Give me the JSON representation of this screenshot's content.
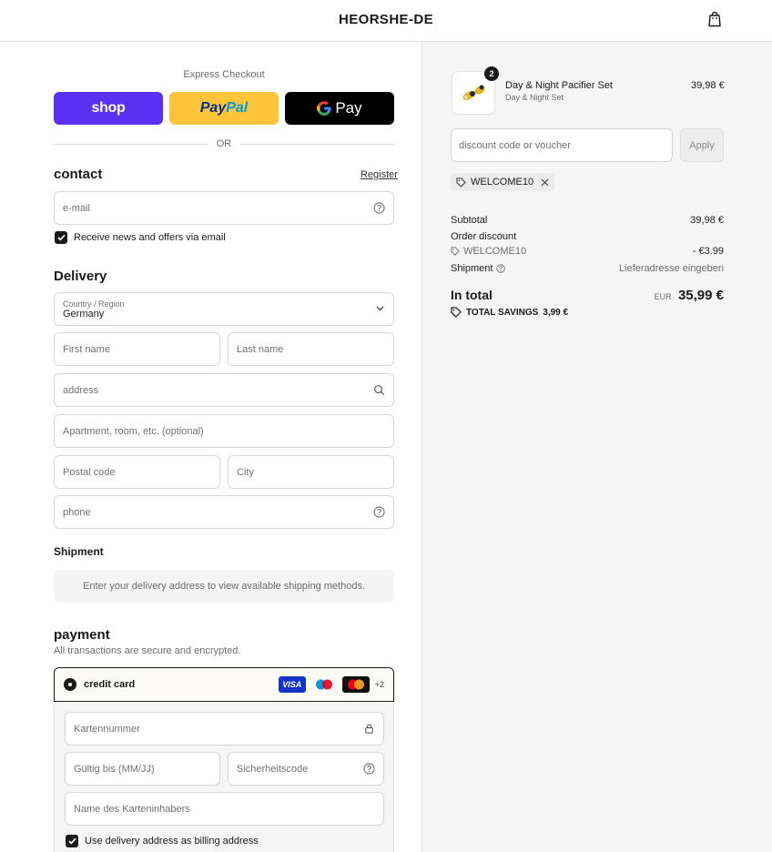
{
  "header": {
    "brand": "HEORSHE-DE",
    "cart_icon": "shopping-bag-icon"
  },
  "express": {
    "title": "Express Checkout",
    "shop_label": "shop",
    "paypal_label_a": "Pay",
    "paypal_label_b": "Pal",
    "gpay_label": "Pay",
    "or_label": "OR"
  },
  "contact": {
    "title": "contact",
    "register_label": "Register",
    "email_placeholder": "e-mail",
    "news_label": "Receive news and offers via email",
    "news_checked": true
  },
  "delivery": {
    "title": "Delivery",
    "country_label": "Country / Region",
    "country_value": "Germany",
    "first_name": "First name",
    "last_name": "Last name",
    "address": "address",
    "apartment": "Apartment, room, etc. (optional)",
    "postal": "Postal code",
    "city": "City",
    "phone": "phone"
  },
  "shipment": {
    "title": "Shipment",
    "message": "Enter your delivery address to view available shipping methods."
  },
  "payment": {
    "title": "payment",
    "subtitle": "All transactions are secure and encrypted.",
    "method_label": "credit card",
    "visa_label": "VISA",
    "more_label": "+2",
    "card_number": "Kartennummer",
    "expiry": "Gültig bis (MM/JJ)",
    "cvc": "Sicherheitscode",
    "name_on_card": "Name des Karteninhabers",
    "billing_label": "Use delivery address as billing address",
    "billing_checked": true
  },
  "summary": {
    "product_name": "Day & Night Pacifier Set",
    "product_variant": "Day & Night Set",
    "product_qty": "2",
    "product_price": "39,98 €",
    "discount_placeholder": "discount code or voucher",
    "apply_label": "Apply",
    "applied_code": "WELCOME10",
    "subtotal_label": "Subtotal",
    "subtotal_value": "39,98 €",
    "order_discount_label": "Order discount",
    "discount_code": "WELCOME10",
    "discount_value": "- €3.99",
    "shipment_label": "Shipment",
    "shipment_value": "Lieferadresse eingeben",
    "total_label": "In total",
    "currency": "EUR",
    "total_value": "35,99 €",
    "savings_label": "TOTAL SAVINGS",
    "savings_value": "3,99 €"
  }
}
